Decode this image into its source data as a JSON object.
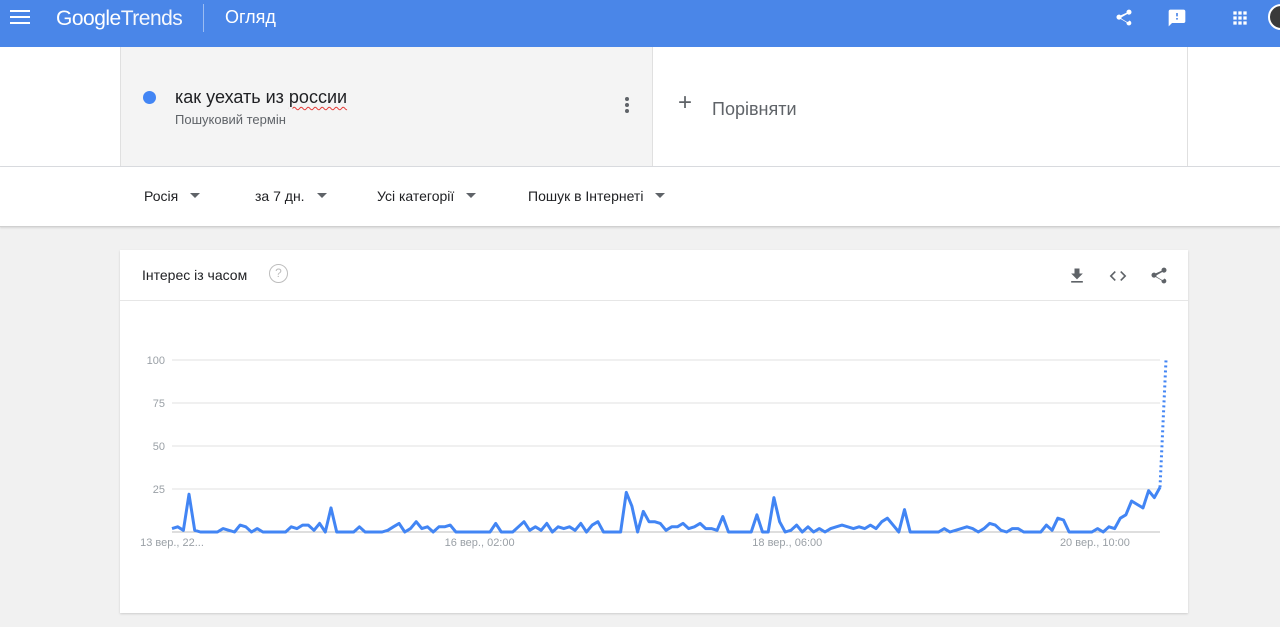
{
  "header": {
    "logo_google": "Google",
    "logo_trends": "Trends",
    "page_title": "Огляд",
    "icons": [
      "menu-icon",
      "share-icon",
      "feedback-icon",
      "apps-icon",
      "avatar"
    ]
  },
  "term": {
    "text_plain": "как уехать из ",
    "text_underlined": "россии",
    "subtitle": "Пошуковий термін",
    "color": "#4285f4"
  },
  "compare": {
    "plus": "+",
    "label": "Порівняти"
  },
  "filters": [
    "Росія",
    "за 7 дн.",
    "Усі категорії",
    "Пошук в Інтернеті"
  ],
  "card": {
    "title": "Інтерес із часом",
    "help": "?",
    "actions": [
      "download-icon",
      "embed-icon",
      "share-icon"
    ]
  },
  "colors": {
    "brand": "#4a86e8",
    "line": "#4285f4",
    "grid": "#e0e0e0"
  },
  "chart_data": {
    "type": "line",
    "yticks": [
      100,
      75,
      50,
      25
    ],
    "ylim": [
      0,
      100
    ],
    "xlim": [
      0,
      167
    ],
    "xticks": [
      {
        "label": "13 вер., 22...",
        "x": 0
      },
      {
        "label": "16 вер., 02:00",
        "x": 52
      },
      {
        "label": "18 вер., 06:00",
        "x": 104
      },
      {
        "label": "20 вер., 10:00",
        "x": 156
      }
    ],
    "grid": true,
    "series": [
      {
        "values": [
          2,
          3,
          1,
          22,
          1,
          0,
          0,
          0,
          0,
          2,
          1,
          0,
          4,
          3,
          0,
          2,
          0,
          0,
          0,
          0,
          0,
          3,
          2,
          4,
          4,
          1,
          5,
          0,
          14,
          0,
          0,
          0,
          0,
          3,
          0,
          0,
          0,
          0,
          1,
          3,
          5,
          0,
          2,
          6,
          2,
          3,
          0,
          3,
          3,
          4,
          0,
          0,
          0,
          0,
          0,
          0,
          0,
          5,
          0,
          0,
          0,
          3,
          6,
          1,
          3,
          1,
          5,
          0,
          3,
          2,
          3,
          1,
          5,
          0,
          4,
          6,
          0,
          0,
          0,
          0,
          23,
          15,
          0,
          12,
          6,
          6,
          5,
          1,
          3,
          3,
          5,
          2,
          3,
          5,
          2,
          2,
          1,
          9,
          0,
          0,
          0,
          0,
          0,
          10,
          0,
          0,
          20,
          6,
          0,
          1,
          4,
          0,
          3,
          0,
          2,
          0,
          2,
          3,
          4,
          3,
          2,
          3,
          2,
          4,
          2,
          6,
          8,
          4,
          0,
          13,
          0,
          0,
          0,
          0,
          0,
          0,
          2,
          0,
          1,
          2,
          3,
          2,
          0,
          2,
          5,
          4,
          1,
          0,
          2,
          2,
          0,
          0,
          0,
          0,
          4,
          1,
          8,
          7,
          0,
          0,
          0,
          0,
          0,
          2,
          0,
          3,
          2,
          8,
          10,
          18,
          16,
          14,
          24,
          20,
          26
        ],
        "dotted_tail": [
          26,
          100
        ]
      }
    ]
  }
}
